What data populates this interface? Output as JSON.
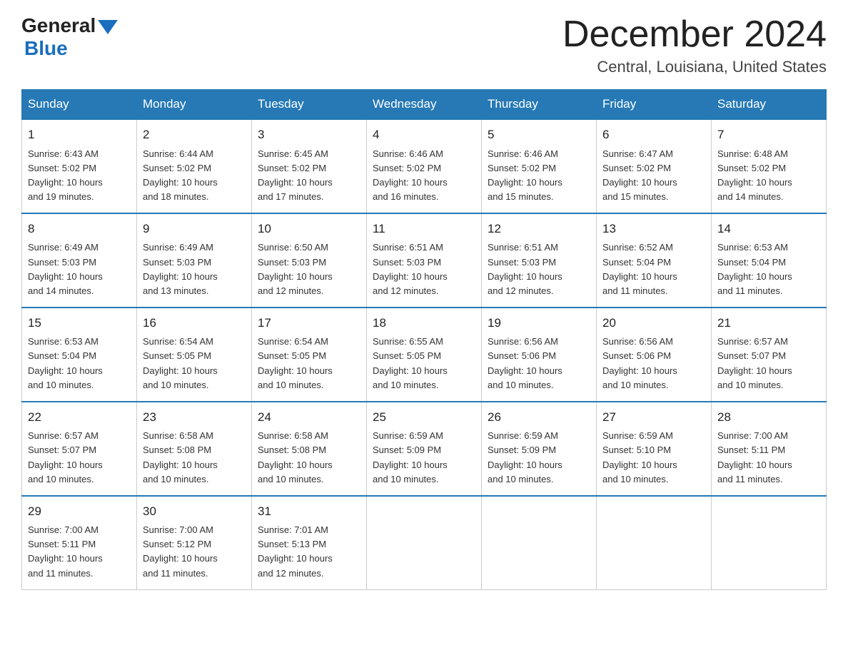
{
  "header": {
    "logo_general": "General",
    "logo_blue": "Blue",
    "month_title": "December 2024",
    "location": "Central, Louisiana, United States"
  },
  "days_of_week": [
    "Sunday",
    "Monday",
    "Tuesday",
    "Wednesday",
    "Thursday",
    "Friday",
    "Saturday"
  ],
  "weeks": [
    [
      {
        "day": 1,
        "sunrise": "6:43 AM",
        "sunset": "5:02 PM",
        "daylight": "10 hours and 19 minutes."
      },
      {
        "day": 2,
        "sunrise": "6:44 AM",
        "sunset": "5:02 PM",
        "daylight": "10 hours and 18 minutes."
      },
      {
        "day": 3,
        "sunrise": "6:45 AM",
        "sunset": "5:02 PM",
        "daylight": "10 hours and 17 minutes."
      },
      {
        "day": 4,
        "sunrise": "6:46 AM",
        "sunset": "5:02 PM",
        "daylight": "10 hours and 16 minutes."
      },
      {
        "day": 5,
        "sunrise": "6:46 AM",
        "sunset": "5:02 PM",
        "daylight": "10 hours and 15 minutes."
      },
      {
        "day": 6,
        "sunrise": "6:47 AM",
        "sunset": "5:02 PM",
        "daylight": "10 hours and 15 minutes."
      },
      {
        "day": 7,
        "sunrise": "6:48 AM",
        "sunset": "5:02 PM",
        "daylight": "10 hours and 14 minutes."
      }
    ],
    [
      {
        "day": 8,
        "sunrise": "6:49 AM",
        "sunset": "5:03 PM",
        "daylight": "10 hours and 14 minutes."
      },
      {
        "day": 9,
        "sunrise": "6:49 AM",
        "sunset": "5:03 PM",
        "daylight": "10 hours and 13 minutes."
      },
      {
        "day": 10,
        "sunrise": "6:50 AM",
        "sunset": "5:03 PM",
        "daylight": "10 hours and 12 minutes."
      },
      {
        "day": 11,
        "sunrise": "6:51 AM",
        "sunset": "5:03 PM",
        "daylight": "10 hours and 12 minutes."
      },
      {
        "day": 12,
        "sunrise": "6:51 AM",
        "sunset": "5:03 PM",
        "daylight": "10 hours and 12 minutes."
      },
      {
        "day": 13,
        "sunrise": "6:52 AM",
        "sunset": "5:04 PM",
        "daylight": "10 hours and 11 minutes."
      },
      {
        "day": 14,
        "sunrise": "6:53 AM",
        "sunset": "5:04 PM",
        "daylight": "10 hours and 11 minutes."
      }
    ],
    [
      {
        "day": 15,
        "sunrise": "6:53 AM",
        "sunset": "5:04 PM",
        "daylight": "10 hours and 10 minutes."
      },
      {
        "day": 16,
        "sunrise": "6:54 AM",
        "sunset": "5:05 PM",
        "daylight": "10 hours and 10 minutes."
      },
      {
        "day": 17,
        "sunrise": "6:54 AM",
        "sunset": "5:05 PM",
        "daylight": "10 hours and 10 minutes."
      },
      {
        "day": 18,
        "sunrise": "6:55 AM",
        "sunset": "5:05 PM",
        "daylight": "10 hours and 10 minutes."
      },
      {
        "day": 19,
        "sunrise": "6:56 AM",
        "sunset": "5:06 PM",
        "daylight": "10 hours and 10 minutes."
      },
      {
        "day": 20,
        "sunrise": "6:56 AM",
        "sunset": "5:06 PM",
        "daylight": "10 hours and 10 minutes."
      },
      {
        "day": 21,
        "sunrise": "6:57 AM",
        "sunset": "5:07 PM",
        "daylight": "10 hours and 10 minutes."
      }
    ],
    [
      {
        "day": 22,
        "sunrise": "6:57 AM",
        "sunset": "5:07 PM",
        "daylight": "10 hours and 10 minutes."
      },
      {
        "day": 23,
        "sunrise": "6:58 AM",
        "sunset": "5:08 PM",
        "daylight": "10 hours and 10 minutes."
      },
      {
        "day": 24,
        "sunrise": "6:58 AM",
        "sunset": "5:08 PM",
        "daylight": "10 hours and 10 minutes."
      },
      {
        "day": 25,
        "sunrise": "6:59 AM",
        "sunset": "5:09 PM",
        "daylight": "10 hours and 10 minutes."
      },
      {
        "day": 26,
        "sunrise": "6:59 AM",
        "sunset": "5:09 PM",
        "daylight": "10 hours and 10 minutes."
      },
      {
        "day": 27,
        "sunrise": "6:59 AM",
        "sunset": "5:10 PM",
        "daylight": "10 hours and 10 minutes."
      },
      {
        "day": 28,
        "sunrise": "7:00 AM",
        "sunset": "5:11 PM",
        "daylight": "10 hours and 11 minutes."
      }
    ],
    [
      {
        "day": 29,
        "sunrise": "7:00 AM",
        "sunset": "5:11 PM",
        "daylight": "10 hours and 11 minutes."
      },
      {
        "day": 30,
        "sunrise": "7:00 AM",
        "sunset": "5:12 PM",
        "daylight": "10 hours and 11 minutes."
      },
      {
        "day": 31,
        "sunrise": "7:01 AM",
        "sunset": "5:13 PM",
        "daylight": "10 hours and 12 minutes."
      },
      null,
      null,
      null,
      null
    ]
  ],
  "labels": {
    "sunrise": "Sunrise:",
    "sunset": "Sunset:",
    "daylight": "Daylight:"
  }
}
